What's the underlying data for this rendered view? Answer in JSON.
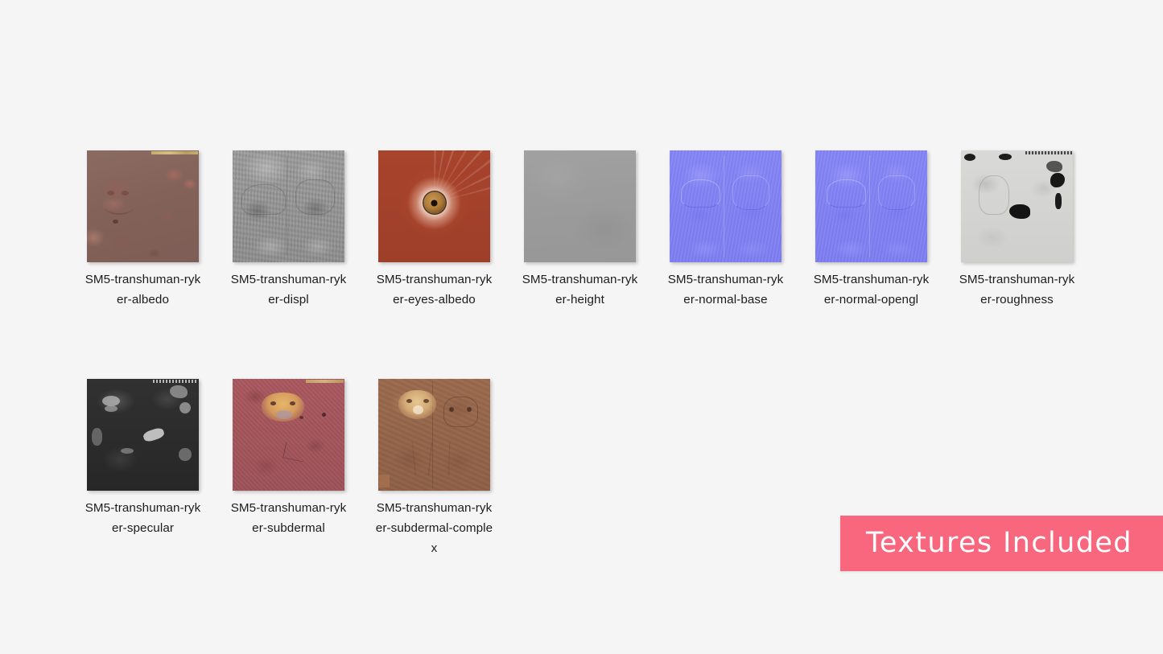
{
  "page": {
    "background_color": "#f5f5f5",
    "label_text_color": "#1c1c1c"
  },
  "texture_grid": {
    "columns": 7,
    "thumbnail_size_px": 139,
    "tiles": [
      {
        "label": "SM5-transhuman-ryker-albedo",
        "map_type": "albedo",
        "thumbnail_kind": "texture-preview",
        "dominant_color": "#836259"
      },
      {
        "label": "SM5-transhuman-ryker-displ",
        "map_type": "displacement",
        "thumbnail_kind": "texture-preview",
        "dominant_color": "#969696"
      },
      {
        "label": "SM5-transhuman-ryker-eyes-albedo",
        "map_type": "eyes-albedo",
        "thumbnail_kind": "texture-preview",
        "dominant_color": "#a3402b"
      },
      {
        "label": "SM5-transhuman-ryker-height",
        "map_type": "height",
        "thumbnail_kind": "texture-preview",
        "dominant_color": "#9b9b9b"
      },
      {
        "label": "SM5-transhuman-ryker-normal-base",
        "map_type": "normal",
        "thumbnail_kind": "texture-preview",
        "dominant_color": "#8080f2"
      },
      {
        "label": "SM5-transhuman-ryker-normal-opengl",
        "map_type": "normal",
        "thumbnail_kind": "texture-preview",
        "dominant_color": "#8080f2"
      },
      {
        "label": "SM5-transhuman-ryker-roughness",
        "map_type": "roughness",
        "thumbnail_kind": "texture-preview",
        "dominant_color": "#d4d4d2"
      },
      {
        "label": "SM5-transhuman-ryker-specular",
        "map_type": "specular",
        "thumbnail_kind": "texture-preview",
        "dominant_color": "#2b2b2b"
      },
      {
        "label": "SM5-transhuman-ryker-subdermal",
        "map_type": "subdermal",
        "thumbnail_kind": "texture-preview",
        "dominant_color": "#a3555b"
      },
      {
        "label": "SM5-transhuman-ryker-subdermal-complex",
        "map_type": "subdermal-complex",
        "thumbnail_kind": "texture-preview",
        "dominant_color": "#93654a"
      }
    ]
  },
  "badge": {
    "text": "Textures Included",
    "background_color": "#f9677e",
    "text_color": "#ffffff"
  }
}
